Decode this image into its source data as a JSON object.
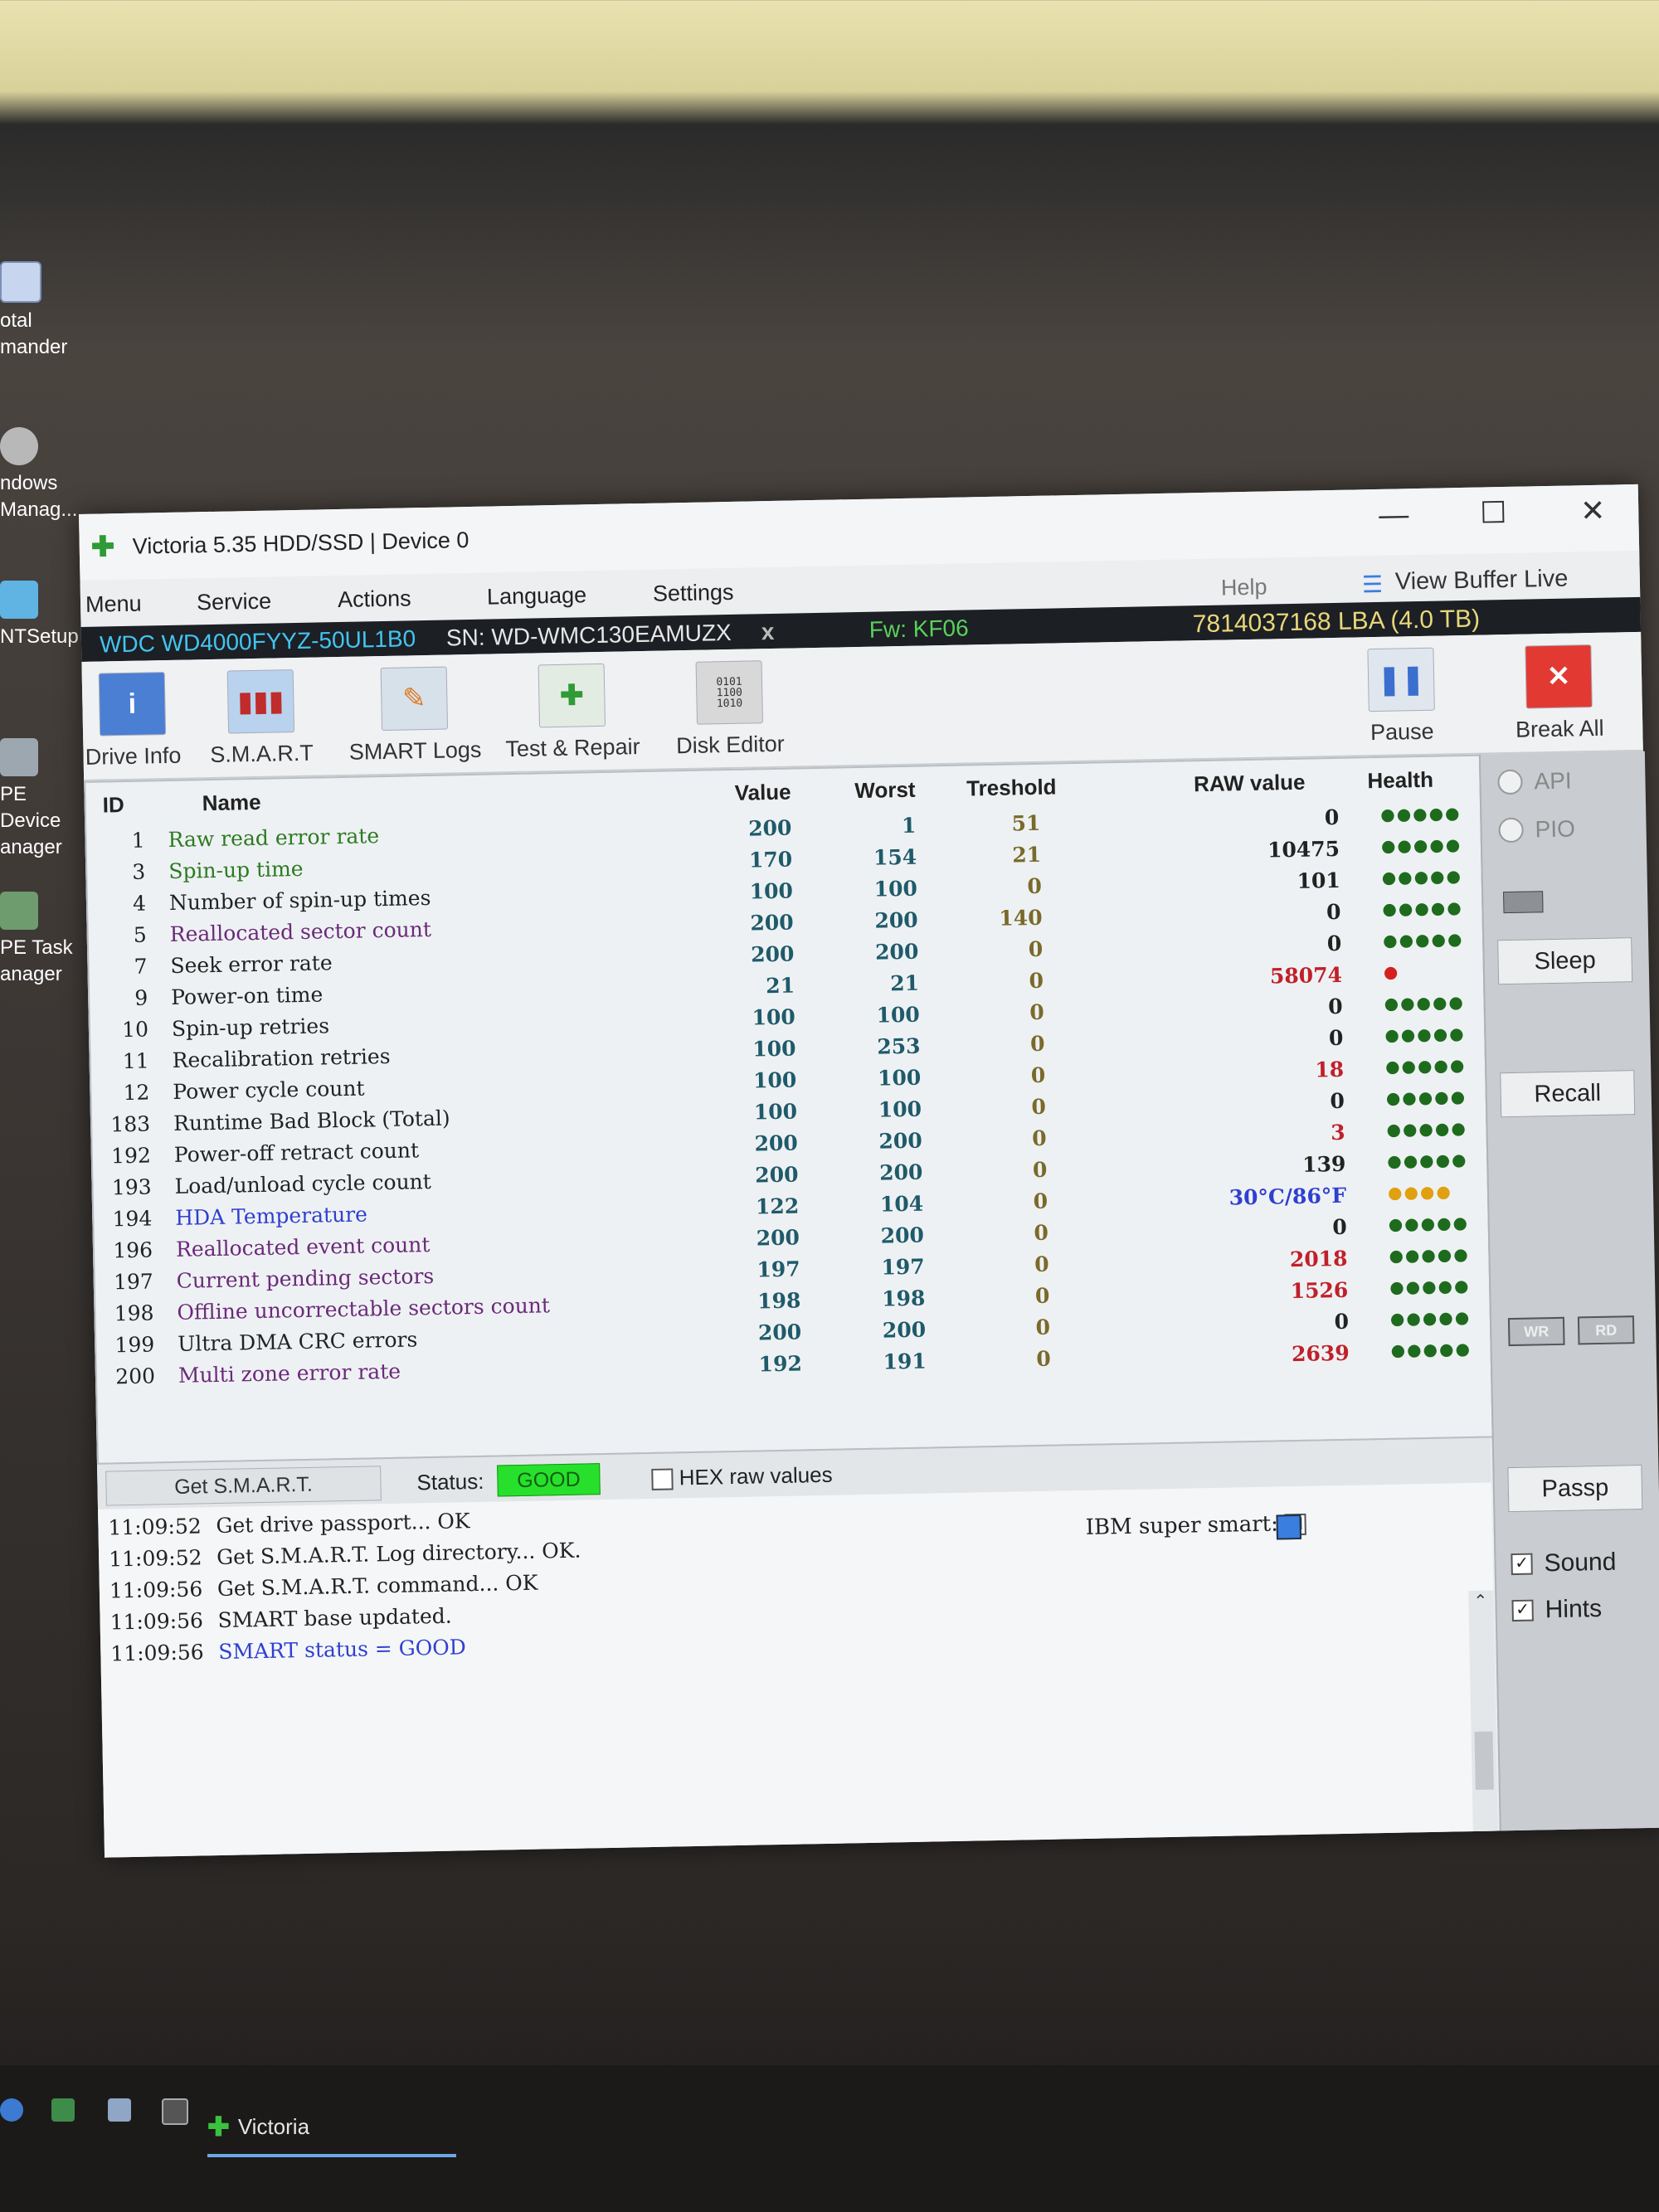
{
  "desktop": {
    "icons": [
      {
        "label": "Total Commander",
        "l1": "otal",
        "l2": "mander"
      },
      {
        "label": "Windows Manager",
        "l1": "ndows",
        "l2": "Manag..."
      },
      {
        "label": "NTSetup",
        "l1": "NTSetup",
        "l2": ""
      },
      {
        "label": "PE Device Manager",
        "l1": "PE Device",
        "l2": "anager"
      },
      {
        "label": "PE Task Manager",
        "l1": "PE Task",
        "l2": "anager"
      }
    ]
  },
  "taskbar": {
    "app_label": "Victoria"
  },
  "window": {
    "title": "Victoria 5.35 HDD/SSD | Device 0",
    "controls": {
      "minimize": "—",
      "maximize": "☐",
      "close": "✕"
    }
  },
  "menu": {
    "items": [
      "Menu",
      "Service",
      "Actions",
      "Language",
      "Settings"
    ],
    "help": "Help",
    "view_buffer": "View Buffer Live"
  },
  "drive": {
    "model": "WDC WD4000FYYZ-50UL1B0",
    "serial": "SN: WD-WMC130EAMUZX",
    "close": "x",
    "firmware": "Fw: KF06",
    "lba": "7814037168 LBA (4.0 TB)",
    "colors": {
      "model": "#43c4f0",
      "serial": "#e6e6e6",
      "firmware": "#59d15a",
      "lba": "#e8d77a"
    }
  },
  "toolbar": {
    "buttons": [
      "Drive Info",
      "S.M.A.R.T",
      "SMART Logs",
      "Test & Repair",
      "Disk Editor"
    ],
    "pause": "Pause",
    "break_all": "Break All"
  },
  "smart": {
    "headers": {
      "id": "ID",
      "name": "Name",
      "value": "Value",
      "worst": "Worst",
      "treshold": "Treshold",
      "raw": "RAW value",
      "health": "Health"
    },
    "rows": [
      {
        "id": "1",
        "name": "Raw read error rate",
        "value": "200",
        "worst": "1",
        "treshold": "51",
        "raw": "0",
        "health": "●●●●●"
      },
      {
        "id": "3",
        "name": "Spin-up time",
        "value": "170",
        "worst": "154",
        "treshold": "21",
        "raw": "10475",
        "health": "●●●●●"
      },
      {
        "id": "4",
        "name": "Number of spin-up times",
        "value": "100",
        "worst": "100",
        "treshold": "0",
        "raw": "101",
        "health": "●●●●●"
      },
      {
        "id": "5",
        "name": "Reallocated sector count",
        "value": "200",
        "worst": "200",
        "treshold": "140",
        "raw": "0",
        "health": "●●●●●"
      },
      {
        "id": "7",
        "name": "Seek error rate",
        "value": "200",
        "worst": "200",
        "treshold": "0",
        "raw": "0",
        "health": "●●●●●"
      },
      {
        "id": "9",
        "name": "Power-on time",
        "value": "21",
        "worst": "21",
        "treshold": "0",
        "raw": "58074",
        "health": "●"
      },
      {
        "id": "10",
        "name": "Spin-up retries",
        "value": "100",
        "worst": "100",
        "treshold": "0",
        "raw": "0",
        "health": "●●●●●"
      },
      {
        "id": "11",
        "name": "Recalibration retries",
        "value": "100",
        "worst": "253",
        "treshold": "0",
        "raw": "0",
        "health": "●●●●●"
      },
      {
        "id": "12",
        "name": "Power cycle count",
        "value": "100",
        "worst": "100",
        "treshold": "0",
        "raw": "18",
        "health": "●●●●●"
      },
      {
        "id": "183",
        "name": "Runtime Bad Block (Total)",
        "value": "100",
        "worst": "100",
        "treshold": "0",
        "raw": "0",
        "health": "●●●●●"
      },
      {
        "id": "192",
        "name": "Power-off retract count",
        "value": "200",
        "worst": "200",
        "treshold": "0",
        "raw": "3",
        "health": "●●●●●"
      },
      {
        "id": "193",
        "name": "Load/unload cycle count",
        "value": "200",
        "worst": "200",
        "treshold": "0",
        "raw": "139",
        "health": "●●●●●"
      },
      {
        "id": "194",
        "name": "HDA Temperature",
        "value": "122",
        "worst": "104",
        "treshold": "0",
        "raw": "30°C/86°F",
        "health": "●●●●"
      },
      {
        "id": "196",
        "name": "Reallocated event count",
        "value": "200",
        "worst": "200",
        "treshold": "0",
        "raw": "0",
        "health": "●●●●●"
      },
      {
        "id": "197",
        "name": "Current pending sectors",
        "value": "197",
        "worst": "197",
        "treshold": "0",
        "raw": "2018",
        "health": "●●●●●"
      },
      {
        "id": "198",
        "name": "Offline uncorrectable sectors count",
        "value": "198",
        "worst": "198",
        "treshold": "0",
        "raw": "1526",
        "health": "●●●●●"
      },
      {
        "id": "199",
        "name": "Ultra DMA CRC errors",
        "value": "200",
        "worst": "200",
        "treshold": "0",
        "raw": "0",
        "health": "●●●●●"
      },
      {
        "id": "200",
        "name": "Multi zone error rate",
        "value": "192",
        "worst": "191",
        "treshold": "0",
        "raw": "2639",
        "health": "●●●●●"
      }
    ]
  },
  "status_bar": {
    "get_smart": "Get S.M.A.R.T.",
    "status_label": "Status:",
    "status_value": "GOOD",
    "hex_label": "HEX raw values",
    "ibm_label": "IBM super smart:",
    "ibm_checked": "☑"
  },
  "log": [
    {
      "time": "11:09:52",
      "text": "Get drive passport... OK"
    },
    {
      "time": "11:09:52",
      "text": "Get S.M.A.R.T. Log directory... OK."
    },
    {
      "time": "11:09:56",
      "text": "Get S.M.A.R.T. command... OK"
    },
    {
      "time": "11:09:56",
      "text": "SMART base updated."
    },
    {
      "time": "11:09:56",
      "text": "SMART status = GOOD"
    }
  ],
  "side_panel": {
    "api": "API",
    "pio": "PIO",
    "sleep": "Sleep",
    "recall": "Recall",
    "wr": "WR",
    "rd": "RD",
    "passp": "Passp",
    "sound": "Sound",
    "hints": "Hints"
  }
}
